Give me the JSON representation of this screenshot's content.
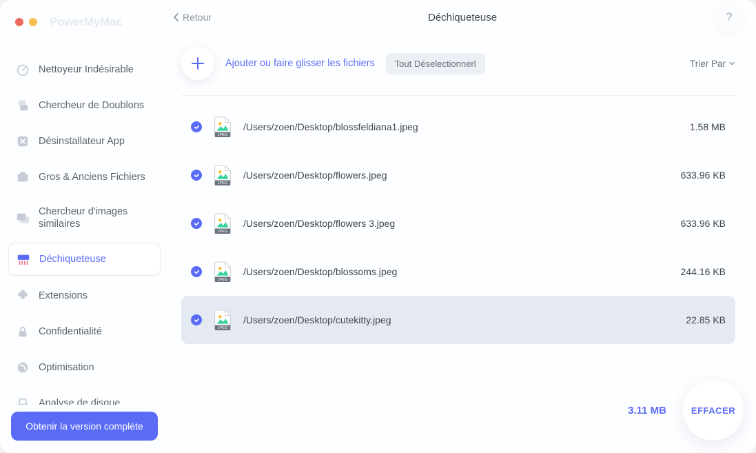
{
  "brand": "PowerMyMac",
  "back_label": "Retour",
  "page_title": "Déchiqueteuse",
  "help_label": "?",
  "toolbar": {
    "add_label": "Ajouter ou faire glisser les fichiers",
    "deselect_label": "Tout Déselectionnerl",
    "sort_label": "Trier Par"
  },
  "sidebar": {
    "items": [
      {
        "label": "Nettoyeur Indésirable",
        "icon": "gauge"
      },
      {
        "label": "Chercheur de Doublons",
        "icon": "duplicates"
      },
      {
        "label": "Désinstallateur App",
        "icon": "uninstall"
      },
      {
        "label": "Gros & Anciens Fichiers",
        "icon": "large-old"
      },
      {
        "label": "Chercheur d'images similaires",
        "icon": "similar"
      },
      {
        "label": "Déchiqueteuse",
        "icon": "shredder",
        "active": true
      },
      {
        "label": "Extensions",
        "icon": "extensions"
      },
      {
        "label": "Confidentialité",
        "icon": "privacy"
      },
      {
        "label": "Optimisation",
        "icon": "optimise"
      },
      {
        "label": "Analyse de disque",
        "icon": "disk"
      }
    ]
  },
  "full_version_label": "Obtenir la version complète",
  "files": [
    {
      "path": "/Users/zoen/Desktop/blossfeldiana1.jpeg",
      "size": "1.58 MB",
      "checked": true
    },
    {
      "path": "/Users/zoen/Desktop/flowers.jpeg",
      "size": "633.96 KB",
      "checked": true
    },
    {
      "path": "/Users/zoen/Desktop/flowers 3.jpeg",
      "size": "633.96 KB",
      "checked": true
    },
    {
      "path": "/Users/zoen/Desktop/blossoms.jpeg",
      "size": "244.16 KB",
      "checked": true
    },
    {
      "path": "/Users/zoen/Desktop/cutekitty.jpeg",
      "size": "22.85 KB",
      "checked": true,
      "highlight": true
    }
  ],
  "total_size": "3.11 MB",
  "erase_label": "EFFACER"
}
